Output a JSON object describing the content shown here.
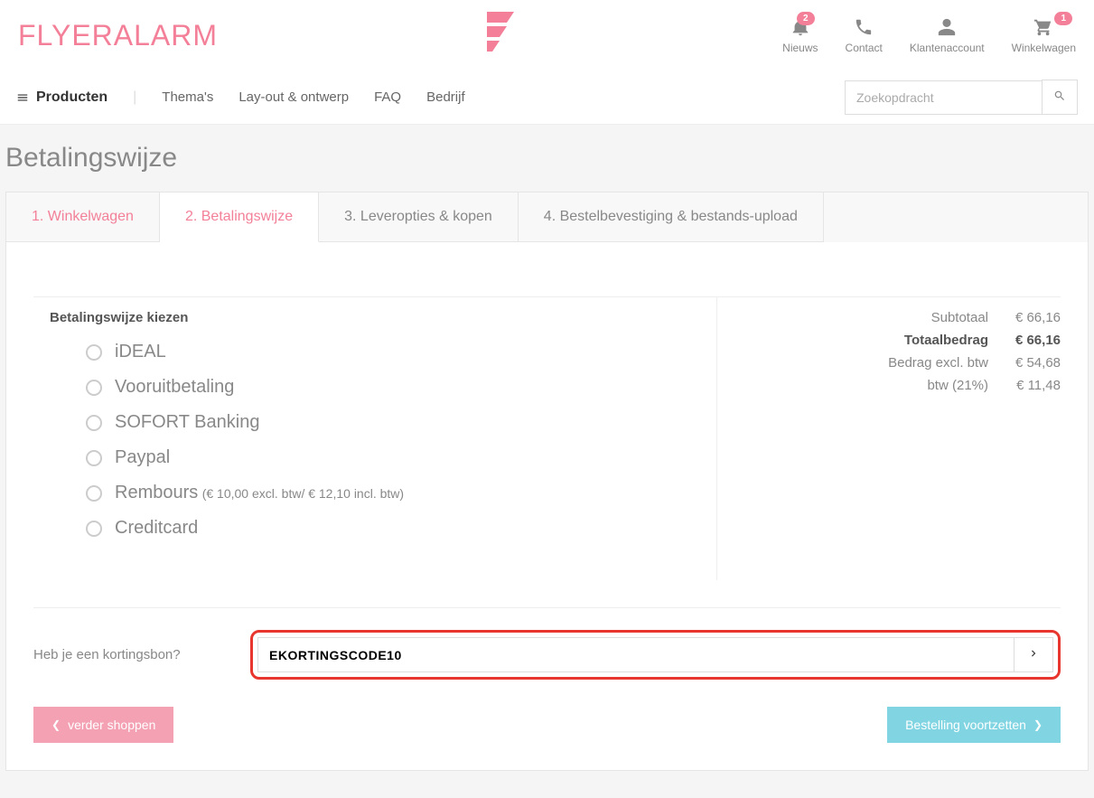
{
  "brand": "FLYERALARM",
  "header": {
    "nieuws": {
      "label": "Nieuws",
      "badge": "2"
    },
    "contact": {
      "label": "Contact"
    },
    "account": {
      "label": "Klantenaccount"
    },
    "cart": {
      "label": "Winkelwagen",
      "badge": "1"
    }
  },
  "nav": {
    "products": "Producten",
    "items": [
      "Thema's",
      "Lay-out & ontwerp",
      "FAQ",
      "Bedrijf"
    ]
  },
  "search": {
    "placeholder": "Zoekopdracht"
  },
  "page_title": "Betalingswijze",
  "tabs": [
    {
      "label": "1. Winkelwagen",
      "active": false,
      "link": true
    },
    {
      "label": "2. Betalingswijze",
      "active": true,
      "link": true
    },
    {
      "label": "3. Leveropties & kopen",
      "active": false,
      "link": false
    },
    {
      "label": "4. Bestelbevestiging & bestands-upload",
      "active": false,
      "link": false
    }
  ],
  "payment": {
    "title": "Betalingswijze kiezen",
    "options": [
      {
        "label": "iDEAL",
        "note": ""
      },
      {
        "label": "Vooruitbetaling",
        "note": ""
      },
      {
        "label": "SOFORT Banking",
        "note": ""
      },
      {
        "label": "Paypal",
        "note": ""
      },
      {
        "label": "Rembours",
        "note": "(€ 10,00 excl. btw/ € 12,10 incl. btw)"
      },
      {
        "label": "Creditcard",
        "note": ""
      }
    ]
  },
  "totals": {
    "rows": [
      {
        "label": "Subtotaal",
        "value": "€ 66,16",
        "bold": false
      },
      {
        "label": "Totaalbedrag",
        "value": "€ 66,16",
        "bold": true
      },
      {
        "label": "Bedrag excl. btw",
        "value": "€ 54,68",
        "bold": false
      },
      {
        "label": "btw (21%)",
        "value": "€ 11,48",
        "bold": false
      }
    ]
  },
  "coupon": {
    "label": "Heb je een kortingsbon?",
    "value": "EKORTINGSCODE10"
  },
  "buttons": {
    "back": "verder shoppen",
    "next": "Bestelling voortzetten"
  }
}
